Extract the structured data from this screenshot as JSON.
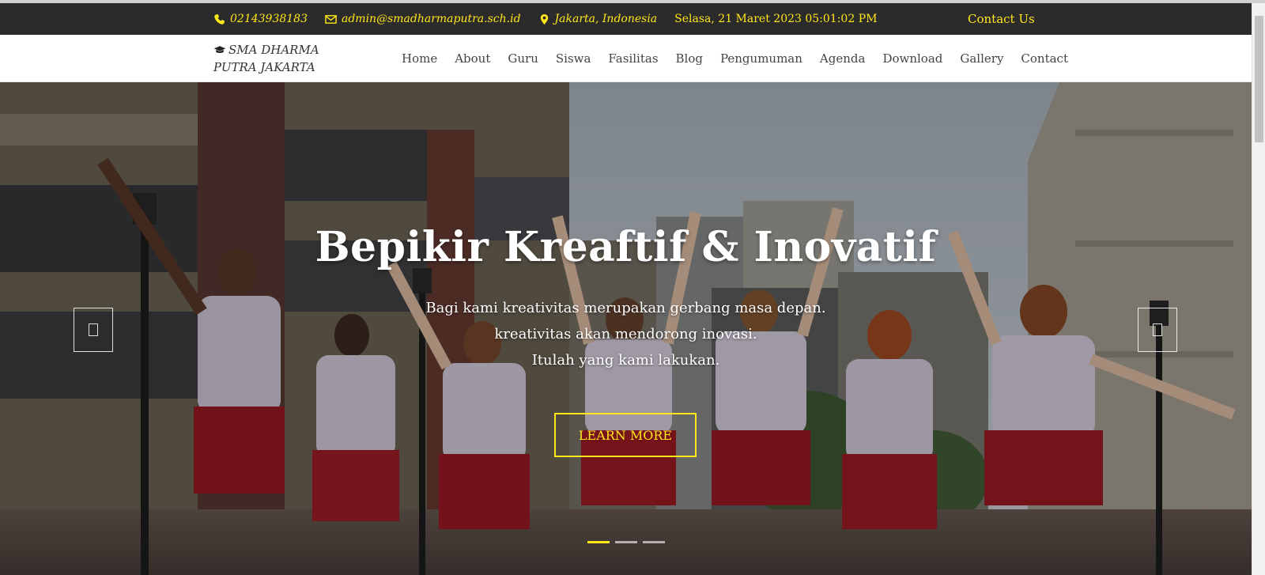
{
  "topbar": {
    "phone": "02143938183",
    "email": "admin@smadharmaputra.sch.id",
    "location": "Jakarta, Indonesia",
    "datetime": "Selasa, 21 Maret 2023 05:01:02 PM",
    "contact_label": "Contact Us",
    "icons": [
      "phone-icon",
      "envelope-icon",
      "map-marker-icon"
    ]
  },
  "navbar": {
    "brand": "SMA DHARMA PUTRA JAKARTA",
    "brand_icon": "graduation-cap-icon",
    "menu": [
      "Home",
      "About",
      "Guru",
      "Siswa",
      "Fasilitas",
      "Blog",
      "Pengumuman",
      "Agenda",
      "Download",
      "Gallery",
      "Contact"
    ]
  },
  "hero": {
    "title": "Bepikir Kreaftif & Inovatif",
    "lines": [
      "Bagi kami kreativitas merupakan gerbang masa depan.",
      "kreativitas akan mendorong inovasi.",
      "Itulah yang kami lakukan."
    ],
    "button_label": "LEARN MORE",
    "slide_count": 3,
    "active_slide": 1,
    "prev_icon": "prev-slide-icon",
    "next_icon": "next-slide-icon"
  },
  "colors": {
    "accent": "#ffe61a",
    "topbar_bg": "#2b2b2b",
    "nav_text": "#444444"
  }
}
